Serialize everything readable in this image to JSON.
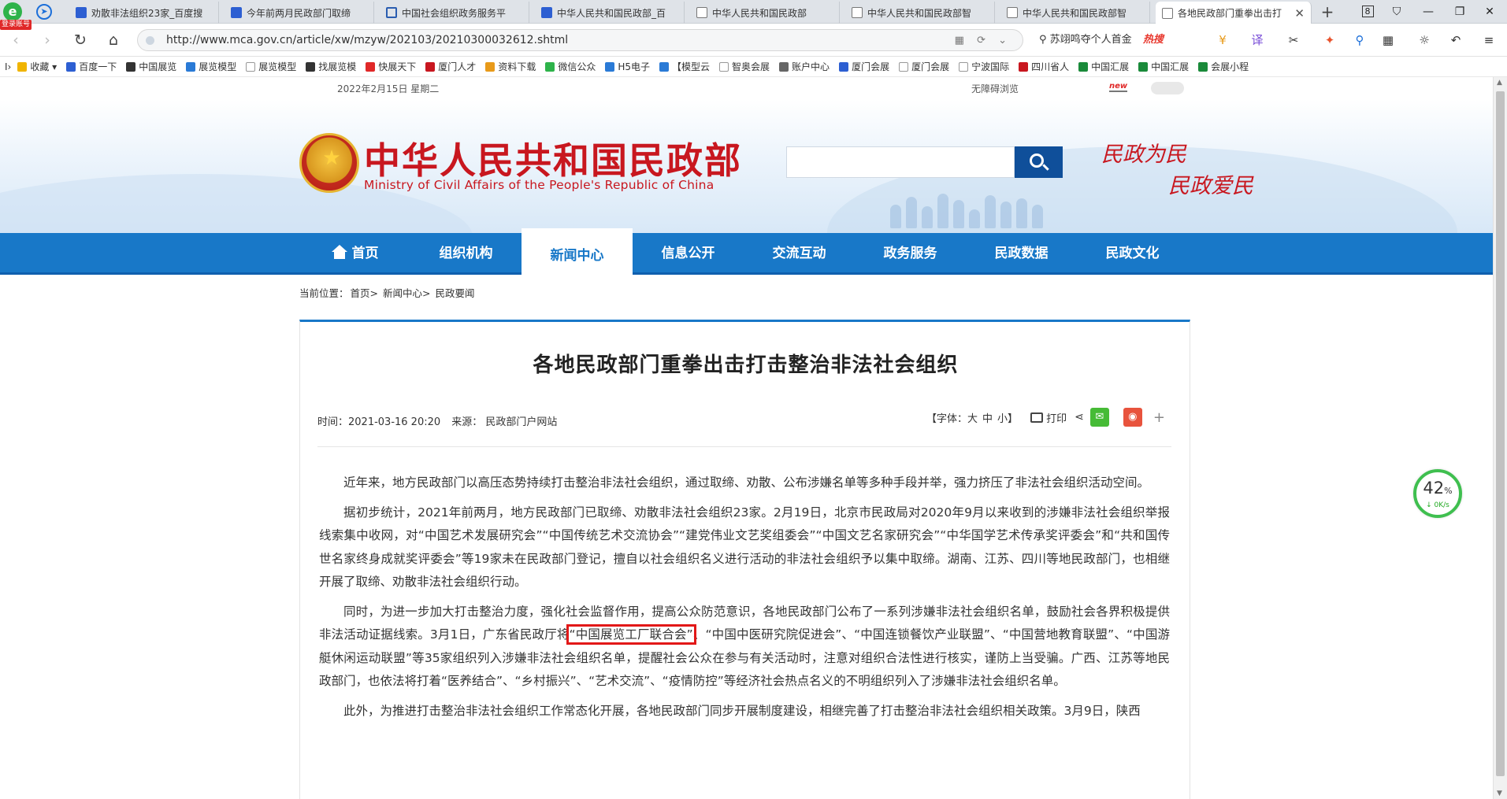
{
  "browser": {
    "badge": "登录账号",
    "tabs": [
      {
        "title": "劝散非法组织23家_百度搜",
        "icon": "paw-icon"
      },
      {
        "title": "今年前两月民政部门取缔",
        "icon": "paw-icon"
      },
      {
        "title": "中国社会组织政务服务平",
        "icon": "e-icon"
      },
      {
        "title": "中华人民共和国民政部_百",
        "icon": "paw-icon"
      },
      {
        "title": "中华人民共和国民政部",
        "icon": "doc-icon"
      },
      {
        "title": "中华人民共和国民政部智",
        "icon": "doc-icon"
      },
      {
        "title": "中华人民共和国民政部智",
        "icon": "doc-icon"
      },
      {
        "title": "各地民政部门重拳出击打",
        "icon": "doc-icon",
        "active": true
      }
    ],
    "tab_count": "8",
    "address": {
      "url": "http://www.mca.gov.cn/article/xw/mzyw/202103/20210300032612.shtml"
    },
    "search": {
      "query": "苏翊鸣夺个人首金",
      "hot_label": "热搜"
    },
    "bookmarks": [
      {
        "label": "收藏",
        "color": "#f0b400"
      },
      {
        "label": "百度一下",
        "color": "#2d5fd2"
      },
      {
        "label": "中国展览",
        "color": "#333333"
      },
      {
        "label": "展览模型",
        "color": "#2a7ad6"
      },
      {
        "label": "展览模型",
        "color": "#999999"
      },
      {
        "label": "找展览模",
        "color": "#333333"
      },
      {
        "label": "快展天下",
        "color": "#e02828"
      },
      {
        "label": "厦门人才",
        "color": "#c8171f"
      },
      {
        "label": "资料下载",
        "color": "#e89a1a"
      },
      {
        "label": "微信公众",
        "color": "#2eb34a"
      },
      {
        "label": "H5电子",
        "color": "#2a7ad6"
      },
      {
        "label": "【模型云",
        "color": "#2a7ad6"
      },
      {
        "label": "智奥会展",
        "color": "#999999"
      },
      {
        "label": "账户中心",
        "color": "#666666"
      },
      {
        "label": "厦门会展",
        "color": "#2d5fd2"
      },
      {
        "label": "厦门会展",
        "color": "#999999"
      },
      {
        "label": "宁波国际",
        "color": "#999999"
      },
      {
        "label": "四川省人",
        "color": "#c8171f"
      },
      {
        "label": "中国汇展",
        "color": "#1a8a3a"
      },
      {
        "label": "中国汇展",
        "color": "#1a8a3a"
      },
      {
        "label": "会展小程",
        "color": "#1a8a3a"
      }
    ]
  },
  "site": {
    "date": "2022年2月15日 星期二",
    "accessibility": "无障碍浏览",
    "new_badge": "new",
    "title": "中华人民共和国民政部",
    "subtitle": "Ministry of Civil Affairs of the People's Republic of China",
    "slogan_line1": "民政为民",
    "slogan_line2": "民政爱民",
    "nav": [
      {
        "label": "首页"
      },
      {
        "label": "组织机构"
      },
      {
        "label": "新闻中心",
        "active": true
      },
      {
        "label": "信息公开"
      },
      {
        "label": "交流互动"
      },
      {
        "label": "政务服务"
      },
      {
        "label": "民政数据"
      },
      {
        "label": "民政文化"
      }
    ],
    "breadcrumb": [
      "当前位置：",
      "首页>",
      "新闻中心>",
      "民政要闻"
    ]
  },
  "article": {
    "title": "各地民政部门重拳出击打击整治非法社会组织",
    "time": "时间：2021-03-16 20:20",
    "source": "来源：  民政部门户网站",
    "font_label": "【字体：",
    "font_large": "大",
    "font_medium": "中",
    "font_small": "小】",
    "print_label": "打印",
    "p1": "近年来，地方民政部门以高压态势持续打击整治非法社会组织，通过取缔、劝散、公布涉嫌名单等多种手段并举，强力挤压了非法社会组织活动空间。",
    "p2": "据初步统计，2021年前两月，地方民政部门已取缔、劝散非法社会组织23家。2月19日，北京市民政局对2020年9月以来收到的涉嫌非法社会组织举报线索集中收网，对“中国艺术发展研究会”“中国传统艺术交流协会”“建党伟业文艺奖组委会”“中国文艺名家研究会”“中华国学艺术传承奖评委会”和“共和国传世名家终身成就奖评委会”等19家未在民政部门登记，擅自以社会组织名义进行活动的非法社会组织予以集中取缔。湖南、江苏、四川等地民政部门，也相继开展了取缔、劝散非法社会组织行动。",
    "p3_pre": "同时，为进一步加大打击整治力度，强化社会监督作用，提高公众防范意识，各地民政部门公布了一系列涉嫌非法社会组织名单，鼓励社会各界积极提供非法活动证据线索。3月1日，广东省民政厅将",
    "p3_highlight": "“中国展览工厂联合会”",
    "p3_post": "、“中国中医研究院促进会”、“中国连锁餐饮产业联盟”、“中国营地教育联盟”、“中国游艇休闲运动联盟”等35家组织列入涉嫌非法社会组织名单，提醒社会公众在参与有关活动时，注意对组织合法性进行核实，谨防上当受骗。广西、江苏等地民政部门，也依法将打着“医养结合”、“乡村振兴”、“艺术交流”、“疫情防控”等经济社会热点名义的不明组织列入了涉嫌非法社会组织名单。",
    "p4": "此外，为推进打击整治非法社会组织工作常态化开展，各地民政部门同步开展制度建设，相继完善了打击整治非法社会组织相关政策。3月9日，陕西"
  },
  "speed_widget": {
    "percent": "42",
    "unit": "%",
    "rate": "0K/s"
  }
}
